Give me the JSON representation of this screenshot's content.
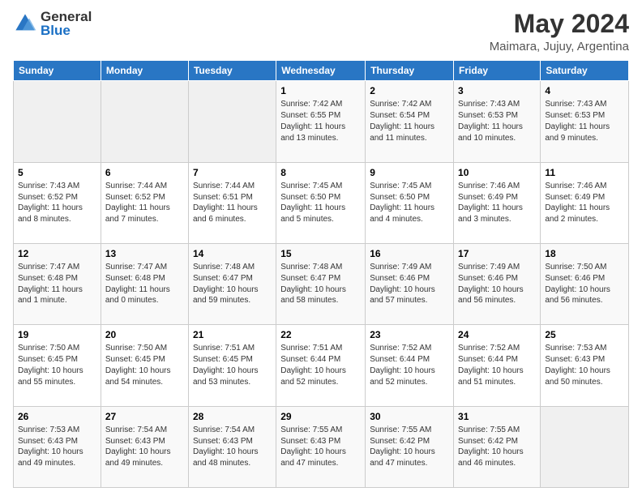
{
  "header": {
    "logo_general": "General",
    "logo_blue": "Blue",
    "main_title": "May 2024",
    "subtitle": "Maimara, Jujuy, Argentina"
  },
  "days_of_week": [
    "Sunday",
    "Monday",
    "Tuesday",
    "Wednesday",
    "Thursday",
    "Friday",
    "Saturday"
  ],
  "weeks": [
    [
      {
        "day": "",
        "text": ""
      },
      {
        "day": "",
        "text": ""
      },
      {
        "day": "",
        "text": ""
      },
      {
        "day": "1",
        "text": "Sunrise: 7:42 AM\nSunset: 6:55 PM\nDaylight: 11 hours\nand 13 minutes."
      },
      {
        "day": "2",
        "text": "Sunrise: 7:42 AM\nSunset: 6:54 PM\nDaylight: 11 hours\nand 11 minutes."
      },
      {
        "day": "3",
        "text": "Sunrise: 7:43 AM\nSunset: 6:53 PM\nDaylight: 11 hours\nand 10 minutes."
      },
      {
        "day": "4",
        "text": "Sunrise: 7:43 AM\nSunset: 6:53 PM\nDaylight: 11 hours\nand 9 minutes."
      }
    ],
    [
      {
        "day": "5",
        "text": "Sunrise: 7:43 AM\nSunset: 6:52 PM\nDaylight: 11 hours\nand 8 minutes."
      },
      {
        "day": "6",
        "text": "Sunrise: 7:44 AM\nSunset: 6:52 PM\nDaylight: 11 hours\nand 7 minutes."
      },
      {
        "day": "7",
        "text": "Sunrise: 7:44 AM\nSunset: 6:51 PM\nDaylight: 11 hours\nand 6 minutes."
      },
      {
        "day": "8",
        "text": "Sunrise: 7:45 AM\nSunset: 6:50 PM\nDaylight: 11 hours\nand 5 minutes."
      },
      {
        "day": "9",
        "text": "Sunrise: 7:45 AM\nSunset: 6:50 PM\nDaylight: 11 hours\nand 4 minutes."
      },
      {
        "day": "10",
        "text": "Sunrise: 7:46 AM\nSunset: 6:49 PM\nDaylight: 11 hours\nand 3 minutes."
      },
      {
        "day": "11",
        "text": "Sunrise: 7:46 AM\nSunset: 6:49 PM\nDaylight: 11 hours\nand 2 minutes."
      }
    ],
    [
      {
        "day": "12",
        "text": "Sunrise: 7:47 AM\nSunset: 6:48 PM\nDaylight: 11 hours\nand 1 minute."
      },
      {
        "day": "13",
        "text": "Sunrise: 7:47 AM\nSunset: 6:48 PM\nDaylight: 11 hours\nand 0 minutes."
      },
      {
        "day": "14",
        "text": "Sunrise: 7:48 AM\nSunset: 6:47 PM\nDaylight: 10 hours\nand 59 minutes."
      },
      {
        "day": "15",
        "text": "Sunrise: 7:48 AM\nSunset: 6:47 PM\nDaylight: 10 hours\nand 58 minutes."
      },
      {
        "day": "16",
        "text": "Sunrise: 7:49 AM\nSunset: 6:46 PM\nDaylight: 10 hours\nand 57 minutes."
      },
      {
        "day": "17",
        "text": "Sunrise: 7:49 AM\nSunset: 6:46 PM\nDaylight: 10 hours\nand 56 minutes."
      },
      {
        "day": "18",
        "text": "Sunrise: 7:50 AM\nSunset: 6:46 PM\nDaylight: 10 hours\nand 56 minutes."
      }
    ],
    [
      {
        "day": "19",
        "text": "Sunrise: 7:50 AM\nSunset: 6:45 PM\nDaylight: 10 hours\nand 55 minutes."
      },
      {
        "day": "20",
        "text": "Sunrise: 7:50 AM\nSunset: 6:45 PM\nDaylight: 10 hours\nand 54 minutes."
      },
      {
        "day": "21",
        "text": "Sunrise: 7:51 AM\nSunset: 6:45 PM\nDaylight: 10 hours\nand 53 minutes."
      },
      {
        "day": "22",
        "text": "Sunrise: 7:51 AM\nSunset: 6:44 PM\nDaylight: 10 hours\nand 52 minutes."
      },
      {
        "day": "23",
        "text": "Sunrise: 7:52 AM\nSunset: 6:44 PM\nDaylight: 10 hours\nand 52 minutes."
      },
      {
        "day": "24",
        "text": "Sunrise: 7:52 AM\nSunset: 6:44 PM\nDaylight: 10 hours\nand 51 minutes."
      },
      {
        "day": "25",
        "text": "Sunrise: 7:53 AM\nSunset: 6:43 PM\nDaylight: 10 hours\nand 50 minutes."
      }
    ],
    [
      {
        "day": "26",
        "text": "Sunrise: 7:53 AM\nSunset: 6:43 PM\nDaylight: 10 hours\nand 49 minutes."
      },
      {
        "day": "27",
        "text": "Sunrise: 7:54 AM\nSunset: 6:43 PM\nDaylight: 10 hours\nand 49 minutes."
      },
      {
        "day": "28",
        "text": "Sunrise: 7:54 AM\nSunset: 6:43 PM\nDaylight: 10 hours\nand 48 minutes."
      },
      {
        "day": "29",
        "text": "Sunrise: 7:55 AM\nSunset: 6:43 PM\nDaylight: 10 hours\nand 47 minutes."
      },
      {
        "day": "30",
        "text": "Sunrise: 7:55 AM\nSunset: 6:42 PM\nDaylight: 10 hours\nand 47 minutes."
      },
      {
        "day": "31",
        "text": "Sunrise: 7:55 AM\nSunset: 6:42 PM\nDaylight: 10 hours\nand 46 minutes."
      },
      {
        "day": "",
        "text": ""
      }
    ]
  ]
}
